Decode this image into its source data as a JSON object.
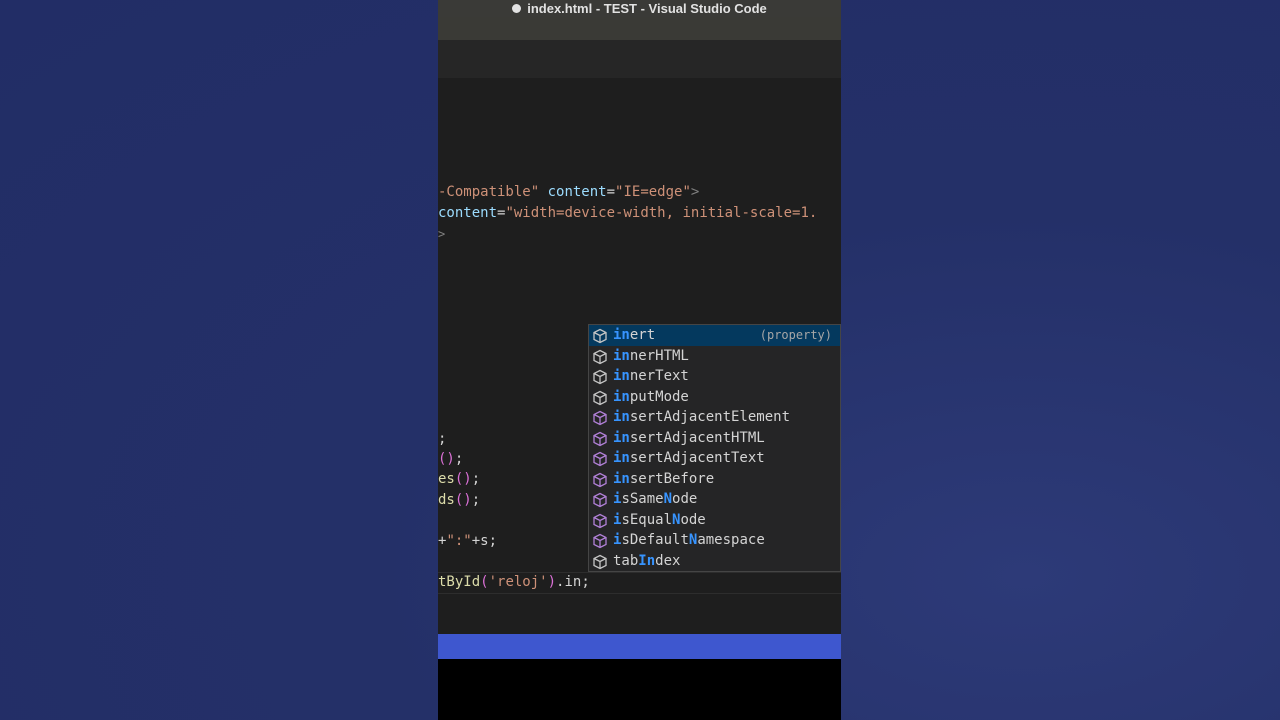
{
  "window": {
    "title": "index.html - TEST - Visual Studio Code"
  },
  "editor": {
    "line1": {
      "t1": "-Compatible\"",
      "t2": " content",
      "t3": "=",
      "t4": "\"IE=edge\"",
      "t5": ">"
    },
    "line2": {
      "t1": "content",
      "t2": "=",
      "t3": "\"width=device-width, initial-scale=1."
    },
    "line3": {
      "t1": ">"
    },
    "line4": {
      "t1": ";"
    },
    "line5": {
      "t1": "()",
      "t2": ";"
    },
    "line6": {
      "t1": "es",
      "t2": "()",
      "t3": ";"
    },
    "line7": {
      "t1": "ds",
      "t2": "()",
      "t3": ";"
    },
    "line8": {
      "t1": "+",
      "t2": "\":\"",
      "t3": "+s;"
    },
    "line9": {
      "t1": "tById",
      "t2": "(",
      "t3": "'reloj'",
      "t4": ")",
      "t5": ".in;"
    }
  },
  "suggestions": {
    "items": [
      {
        "pre": "",
        "hl": "in",
        "post": "ert",
        "hl2": "",
        "post2": "",
        "detail": "(property)",
        "kind": "property"
      },
      {
        "pre": "",
        "hl": "in",
        "post": "nerHTML",
        "hl2": "",
        "post2": "",
        "kind": "property"
      },
      {
        "pre": "",
        "hl": "in",
        "post": "nerText",
        "hl2": "",
        "post2": "",
        "kind": "property"
      },
      {
        "pre": "",
        "hl": "in",
        "post": "putMode",
        "hl2": "",
        "post2": "",
        "kind": "property"
      },
      {
        "pre": "",
        "hl": "in",
        "post": "sertAdjacentElement",
        "hl2": "",
        "post2": "",
        "kind": "method"
      },
      {
        "pre": "",
        "hl": "in",
        "post": "sertAdjacentHTML",
        "hl2": "",
        "post2": "",
        "kind": "method"
      },
      {
        "pre": "",
        "hl": "in",
        "post": "sertAdjacentText",
        "hl2": "",
        "post2": "",
        "kind": "method"
      },
      {
        "pre": "",
        "hl": "in",
        "post": "sertBefore",
        "hl2": "",
        "post2": "",
        "kind": "method"
      },
      {
        "pre": "",
        "hl": "i",
        "post": "sSame",
        "hl2": "N",
        "post2": "ode",
        "kind": "method"
      },
      {
        "pre": "",
        "hl": "i",
        "post": "sEqual",
        "hl2": "N",
        "post2": "ode",
        "kind": "method"
      },
      {
        "pre": "",
        "hl": "i",
        "post": "sDefault",
        "hl2": "N",
        "post2": "amespace",
        "kind": "method"
      },
      {
        "pre": "tab",
        "hl": "In",
        "post": "dex",
        "hl2": "",
        "post2": "",
        "kind": "property"
      }
    ]
  },
  "colors": {
    "property_icon": "#c5c5c5",
    "method_icon": "#b180d7",
    "match_highlight": "#3794ff",
    "status_bar": "#3e57cf",
    "background": "#232f6a"
  },
  "icons": {
    "property": "cube-outline-icon",
    "method": "cube-icon"
  }
}
